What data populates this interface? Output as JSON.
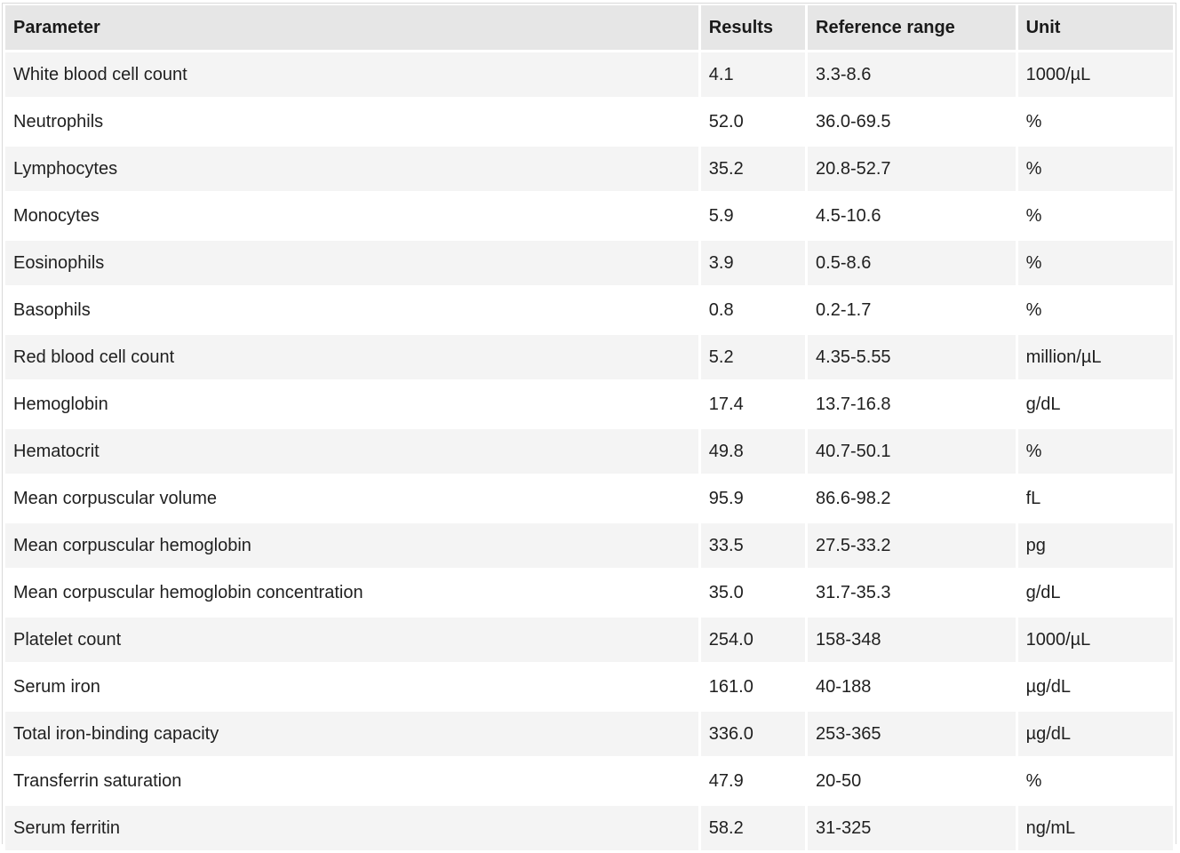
{
  "table": {
    "headers": [
      "Parameter",
      "Results",
      "Reference range",
      "Unit"
    ],
    "rows": [
      [
        "White blood cell count",
        "4.1",
        "3.3-8.6",
        "1000/µL"
      ],
      [
        "Neutrophils",
        "52.0",
        "36.0-69.5",
        "%"
      ],
      [
        "Lymphocytes",
        "35.2",
        "20.8-52.7",
        "%"
      ],
      [
        "Monocytes",
        "5.9",
        "4.5-10.6",
        "%"
      ],
      [
        "Eosinophils",
        "3.9",
        "0.5-8.6",
        "%"
      ],
      [
        "Basophils",
        "0.8",
        "0.2-1.7",
        "%"
      ],
      [
        "Red blood cell count",
        "5.2",
        "4.35-5.55",
        "million/µL"
      ],
      [
        "Hemoglobin",
        "17.4",
        "13.7-16.8",
        "g/dL"
      ],
      [
        "Hematocrit",
        "49.8",
        "40.7-50.1",
        "%"
      ],
      [
        "Mean corpuscular volume",
        "95.9",
        "86.6-98.2",
        "fL"
      ],
      [
        "Mean corpuscular hemoglobin",
        "33.5",
        "27.5-33.2",
        "pg"
      ],
      [
        "Mean corpuscular hemoglobin concentration",
        "35.0",
        "31.7-35.3",
        "g/dL"
      ],
      [
        "Platelet count",
        "254.0",
        "158-348",
        "1000/µL"
      ],
      [
        "Serum iron",
        "161.0",
        "40-188",
        "µg/dL"
      ],
      [
        "Total iron-binding capacity",
        "336.0",
        "253-365",
        "µg/dL"
      ],
      [
        "Transferrin saturation",
        "47.9",
        "20-50",
        "%"
      ],
      [
        "Serum ferritin",
        "58.2",
        "31-325",
        "ng/mL"
      ]
    ]
  },
  "colors": {
    "header_bg": "#e6e6e6",
    "row_odd_bg": "#f4f4f4",
    "row_even_bg": "#ffffff",
    "text": "#1f1f1f"
  }
}
